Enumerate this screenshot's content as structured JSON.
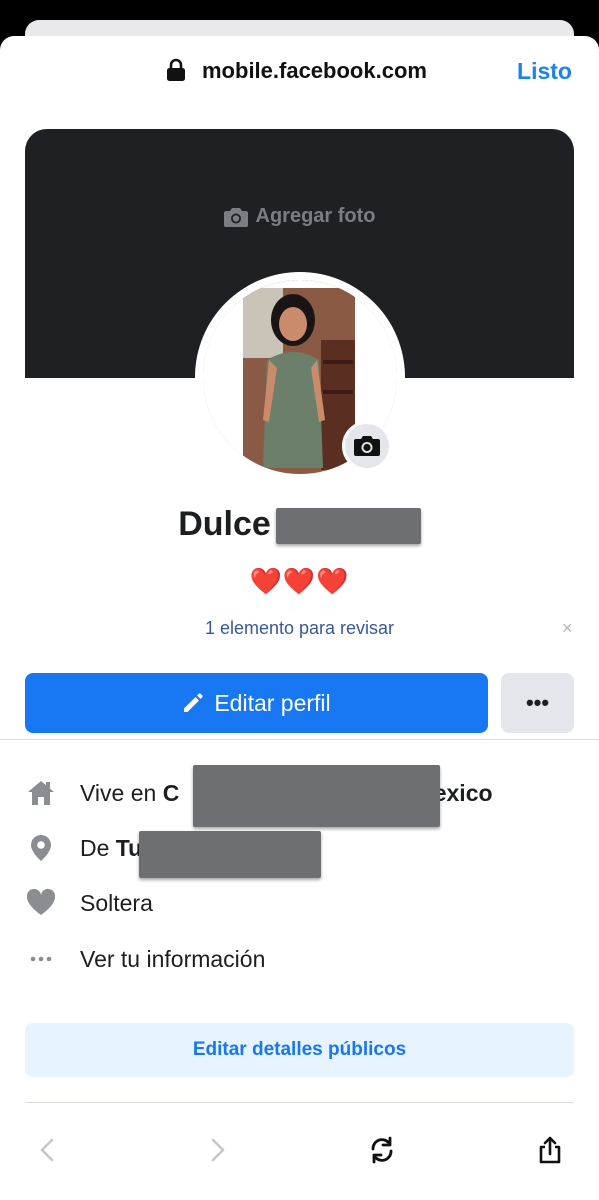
{
  "browser": {
    "url": "mobile.facebook.com",
    "done_label": "Listo"
  },
  "cover": {
    "add_photo_label": "Agregar foto"
  },
  "profile": {
    "name_visible": "Dulce",
    "bio": "❤️❤️❤️",
    "review_text": "1 elemento para revisar",
    "close_glyph": "×"
  },
  "actions": {
    "edit_profile_label": "Editar perfil",
    "more_glyph": "•••"
  },
  "details": [
    {
      "icon": "home-icon",
      "prefix": "Vive en ",
      "bold": "C",
      "suffix": "lexico"
    },
    {
      "icon": "location-pin-icon",
      "prefix": "De ",
      "bold": "Tu",
      "suffix": ""
    },
    {
      "icon": "heart-icon",
      "prefix": "Soltera",
      "bold": "",
      "suffix": ""
    },
    {
      "icon": "more-dots-icon",
      "prefix": "Ver tu información",
      "bold": "",
      "suffix": ""
    }
  ],
  "edit_public_details_label": "Editar detalles públicos",
  "toolbar": {
    "back_glyph": "<",
    "forward_glyph": ">"
  },
  "colors": {
    "accent": "#1877f2",
    "listo": "#1b82f0",
    "cover": "#1f2024",
    "review_link": "#385898",
    "redaction": "#6e6f72"
  }
}
